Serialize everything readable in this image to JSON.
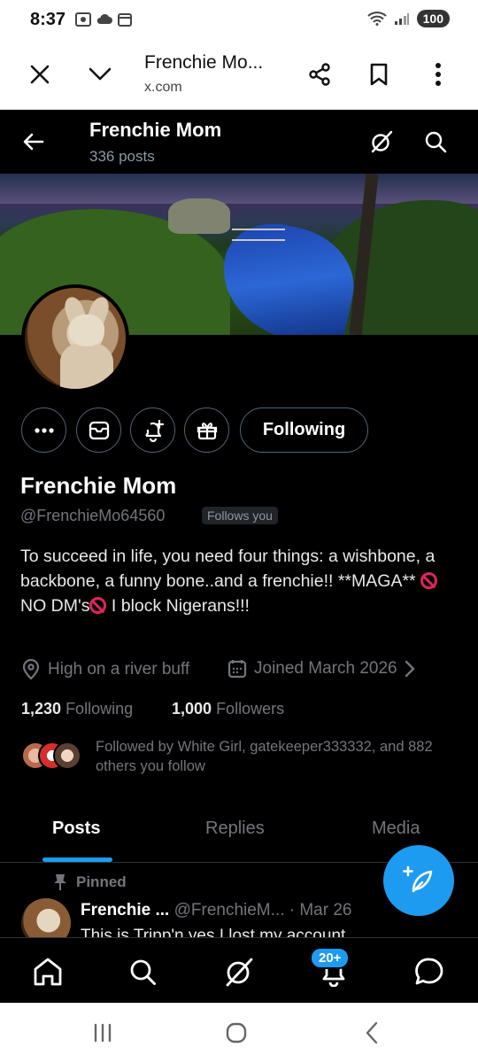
{
  "status_bar": {
    "time": "8:37",
    "battery": "100",
    "icons": [
      "screenshot-icon",
      "cloud-icon",
      "calendar-icon",
      "wifi-icon",
      "signal-icon"
    ]
  },
  "browser": {
    "page_title": "Frenchie Mo...",
    "url": "x.com",
    "buttons": [
      "close-icon",
      "chevron-down-icon",
      "share-icon",
      "bookmark-icon",
      "more-vert-icon"
    ]
  },
  "header": {
    "name": "Frenchie Mom",
    "post_count": "336 posts"
  },
  "profile": {
    "display_name": "Frenchie Mom",
    "handle": "@FrenchieMo64560",
    "follows_you": "Follows you",
    "bio_part1": "To succeed in life, you need four things: a wishbone, a backbone, a funny bone..and a frenchie!!  **MAGA** ",
    "bio_part2": "NO DM's",
    "bio_part3": " I block Nigerans!!!",
    "location": "High on a river buff",
    "joined": "Joined March 2026",
    "following_count": "1,230",
    "following_label": "Following",
    "followers_count": "1,000",
    "followers_label": "Followers",
    "followed_by": "Followed by White Girl, gatekeeper333332, and 882 others you follow",
    "following_button": "Following"
  },
  "tabs": [
    {
      "label": "Posts",
      "active": true
    },
    {
      "label": "Replies",
      "active": false
    },
    {
      "label": "Media",
      "active": false
    }
  ],
  "pinned_post": {
    "pinned_label": "Pinned",
    "name": "Frenchie ...",
    "handle": "@FrenchieM...",
    "date": "· Mar 26",
    "text": "This is Tripp'n  yes I lost my account"
  },
  "bottom_nav": {
    "notifications_badge": "20+"
  },
  "colors": {
    "accent": "#1d9bf0",
    "background": "#000000",
    "muted": "#71767b"
  }
}
